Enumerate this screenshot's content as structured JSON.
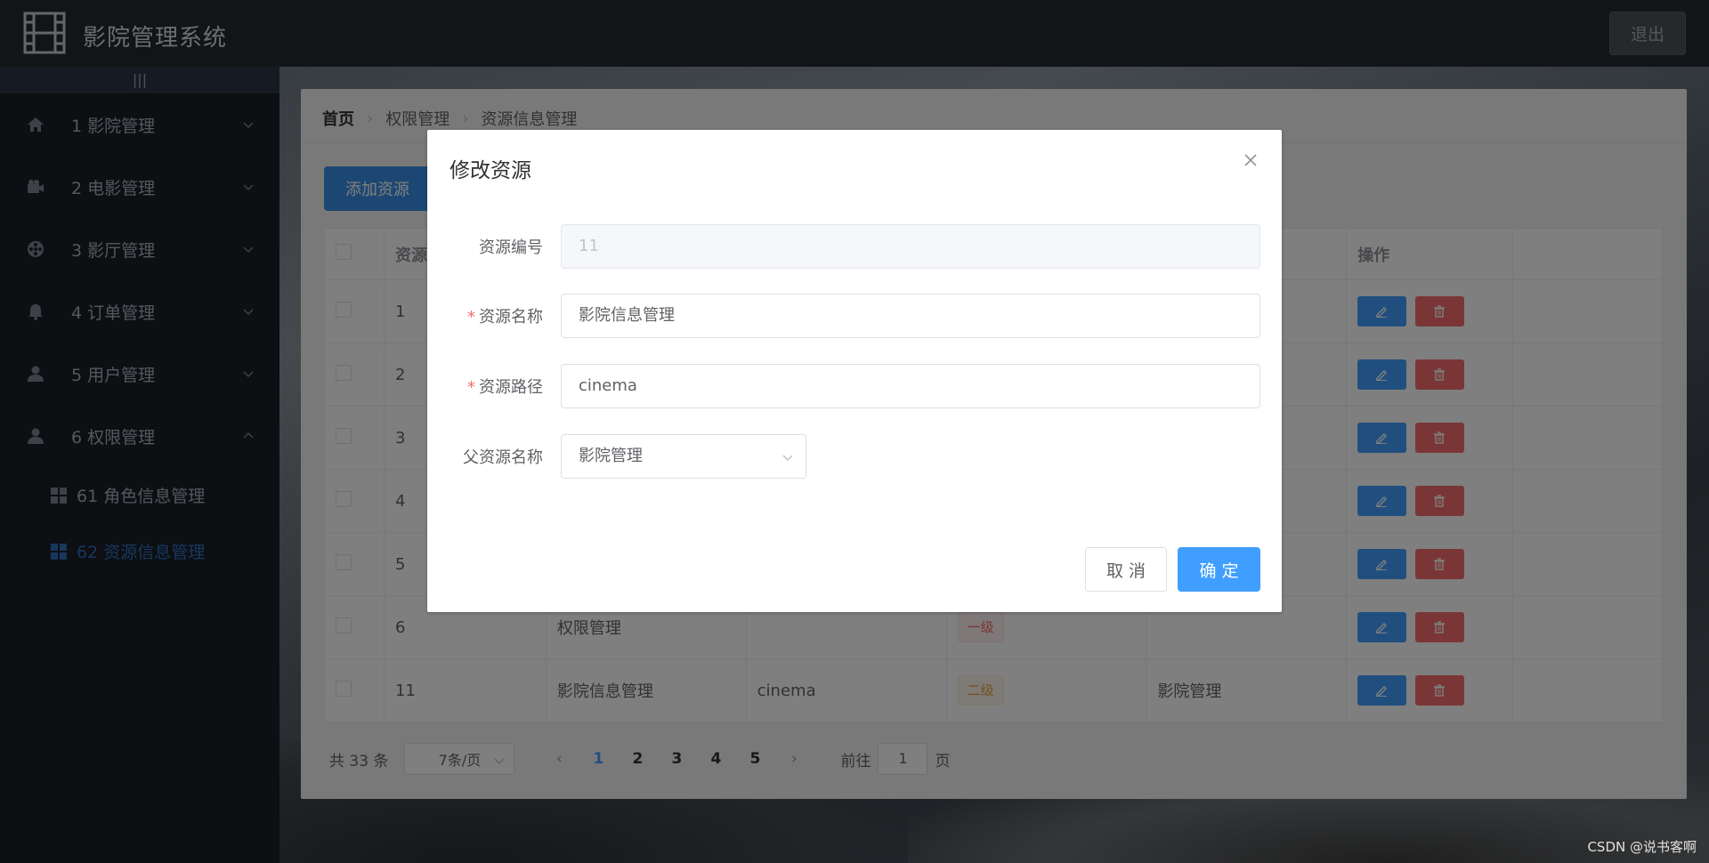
{
  "header": {
    "title": "影院管理系统",
    "logout_label": "退出"
  },
  "sidebar": {
    "collapse_glyph": "|||",
    "menu": [
      {
        "label": "1 影院管理",
        "icon": "home-icon"
      },
      {
        "label": "2 电影管理",
        "icon": "camera-icon"
      },
      {
        "label": "3 影厅管理",
        "icon": "film-reel-icon"
      },
      {
        "label": "4 订单管理",
        "icon": "bell-icon"
      },
      {
        "label": "5 用户管理",
        "icon": "user-icon"
      },
      {
        "label": "6 权限管理",
        "icon": "user-icon"
      }
    ],
    "submenu": [
      {
        "label": "61 角色信息管理",
        "icon": "grid-icon"
      },
      {
        "label": "62 资源信息管理",
        "icon": "grid-icon",
        "active": true
      }
    ]
  },
  "breadcrumb": {
    "home": "首页",
    "level1": "权限管理",
    "level2": "资源信息管理"
  },
  "toolbar": {
    "add_label": "添加资源"
  },
  "table": {
    "headers": {
      "col2": "资源",
      "actions": "操作"
    },
    "rows": [
      {
        "id": "1",
        "name": "",
        "path": "",
        "level": "",
        "parent": ""
      },
      {
        "id": "2",
        "name": "",
        "path": "",
        "level": "",
        "parent": ""
      },
      {
        "id": "3",
        "name": "",
        "path": "",
        "level": "",
        "parent": ""
      },
      {
        "id": "4",
        "name": "",
        "path": "",
        "level": "",
        "parent": ""
      },
      {
        "id": "5",
        "name": "",
        "path": "",
        "level": "",
        "parent": ""
      },
      {
        "id": "6",
        "name": "权限管理",
        "path": "",
        "level": "一级",
        "parent": ""
      },
      {
        "id": "11",
        "name": "影院信息管理",
        "path": "cinema",
        "level": "二级",
        "parent": "影院管理"
      }
    ]
  },
  "pagination": {
    "total": "共 33 条",
    "page_size": "7条/页",
    "pages": [
      "1",
      "2",
      "3",
      "4",
      "5"
    ],
    "current": "1",
    "goto_prefix": "前往",
    "goto_value": "1",
    "goto_suffix": "页"
  },
  "dialog": {
    "title": "修改资源",
    "fields": {
      "id_label": "资源编号",
      "id_value": "11",
      "name_label": "资源名称",
      "name_value": "影院信息管理",
      "path_label": "资源路径",
      "path_value": "cinema",
      "parent_label": "父资源名称",
      "parent_value": "影院管理",
      "required_mark": "*"
    },
    "cancel_label": "取 消",
    "ok_label": "确 定"
  },
  "watermark": "CSDN @说书客啊",
  "colors": {
    "primary": "#409eff",
    "danger": "#f56c6c",
    "sidebar_bg": "#1a1f27",
    "header_bg": "#242a30"
  }
}
